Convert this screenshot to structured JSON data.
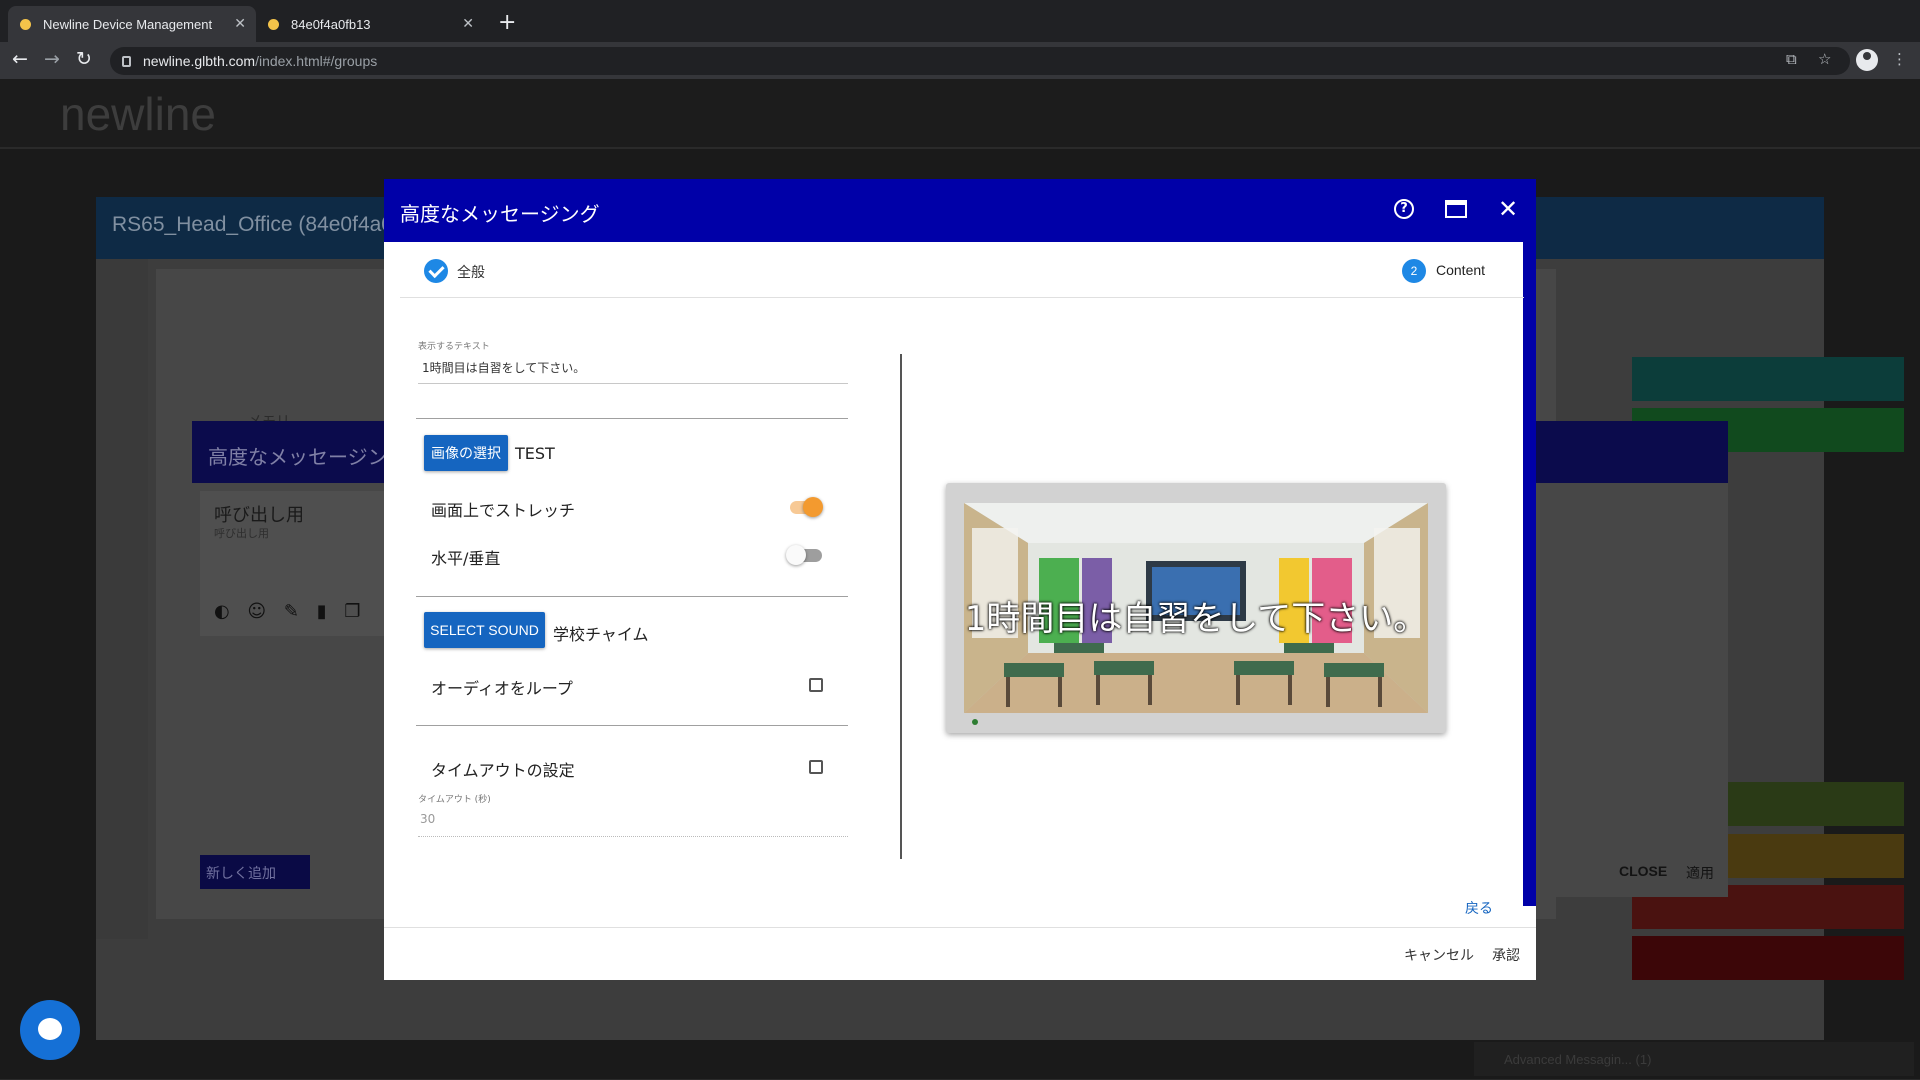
{
  "browser": {
    "tabs": [
      {
        "title": "Newline Device Management",
        "active": true
      },
      {
        "title": "84e0f4a0fb13",
        "active": false
      }
    ],
    "url_host": "newline.glbth.com",
    "url_path": "/index.html#/groups"
  },
  "background_app": {
    "brand": "newline",
    "device_window_title": "RS65_Head_Office (84e0f4a0f",
    "memory_label": "メモリ",
    "dialog_title": "高度なメッセージン",
    "card_title": "呼び出し用",
    "card_subtitle": "呼び出し用",
    "add_new_label": "新しく追加",
    "close_label": "CLOSE",
    "apply_label": "適用",
    "taskbar_item": "Advanced Messagin... (1)",
    "strip_colors": [
      "#0c3d3a",
      "#114a1e",
      "#2a3a16",
      "#4a3a10",
      "#4a1210",
      "#3c0608"
    ]
  },
  "modal": {
    "title": "高度なメッセージング",
    "header_icons": [
      "help-icon",
      "maximize-icon",
      "close-icon"
    ],
    "steps": [
      {
        "label": "全般",
        "state": "complete"
      },
      {
        "number": "2",
        "label": "Content",
        "state": "active"
      }
    ],
    "text_field": {
      "label": "表示するテキスト",
      "value": "1時間目は自習をして下さい。"
    },
    "image": {
      "button": "画像の選択",
      "selected": "TEST"
    },
    "stretch": {
      "label": "画面上でストレッチ",
      "on": true
    },
    "orientation": {
      "label": "水平/垂直",
      "on": false
    },
    "sound": {
      "button": "SELECT SOUND",
      "selected": "学校チャイム"
    },
    "loop_audio": {
      "label": "オーディオをループ",
      "checked": false
    },
    "timeout": {
      "label": "タイムアウトの設定",
      "checked": false,
      "field_label": "タイムアウト (秒)",
      "field_value": "30"
    },
    "preview": {
      "text": "1時間目は自習をして下さい。"
    },
    "back_label": "戻る",
    "cancel_label": "キャンセル",
    "confirm_label": "承認",
    "colors": {
      "header": "#0000a8",
      "accent": "#1565c0",
      "toggle_on": "#f39a2f"
    }
  }
}
